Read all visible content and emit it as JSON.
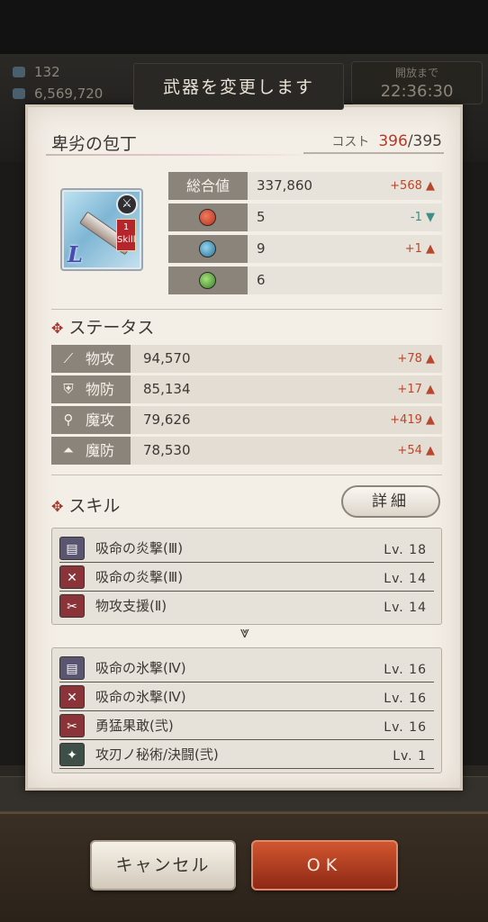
{
  "background": {
    "stat1": "132",
    "stat2": "6,569,720",
    "timer_label": "開放まで",
    "timer": "22:36:30"
  },
  "dialog": {
    "title": "武器を変更します",
    "weapon_name": "卑劣の包丁",
    "cost_label": "コスト",
    "cost_current": "396",
    "cost_max": "/395",
    "icon": {
      "sword_badge": "sword-icon",
      "skill_level": "1",
      "skill_text": "Skill",
      "rarity": "L"
    },
    "summary": [
      {
        "label": "総合値",
        "value": "337,860",
        "diff": "+568 ▲",
        "trend": "up"
      },
      {
        "label": "fire-orb-icon",
        "value": "5",
        "diff": "-1 ▼",
        "trend": "down"
      },
      {
        "label": "water-orb-icon",
        "value": "9",
        "diff": "+1 ▲",
        "trend": "up"
      },
      {
        "label": "wind-orb-icon",
        "value": "6",
        "diff": "",
        "trend": ""
      }
    ],
    "status_title": "ステータス",
    "status": [
      {
        "label": "物攻",
        "value": "94,570",
        "diff": "+78 ▲"
      },
      {
        "label": "物防",
        "value": "85,134",
        "diff": "+17 ▲"
      },
      {
        "label": "魔攻",
        "value": "79,626",
        "diff": "+419 ▲"
      },
      {
        "label": "魔防",
        "value": "78,530",
        "diff": "+54 ▲"
      }
    ],
    "skill_title": "スキル",
    "detail_button": "詳細",
    "current_skills": [
      {
        "name": "吸命の炎撃(Ⅲ)",
        "level": "Lv. 18"
      },
      {
        "name": "吸命の炎撃(Ⅲ)",
        "level": "Lv. 14"
      },
      {
        "name": "物攻支援(Ⅱ)",
        "level": "Lv. 14"
      }
    ],
    "new_skills": [
      {
        "name": "吸命の氷撃(Ⅳ)",
        "level": "Lv. 16"
      },
      {
        "name": "吸命の氷撃(Ⅳ)",
        "level": "Lv. 16"
      },
      {
        "name": "勇猛果敢(弐)",
        "level": "Lv. 16"
      },
      {
        "name": "攻刃ノ秘術/決闘(弐)",
        "level": "Lv.  1"
      }
    ]
  },
  "footer": {
    "cancel_label": "キャンセル",
    "ok_label": "OK"
  },
  "colors": {
    "accent_up": "#b8482d",
    "accent_down": "#3f8d86",
    "ok_button": "#b6401f",
    "header_cell": "#8b847b"
  }
}
